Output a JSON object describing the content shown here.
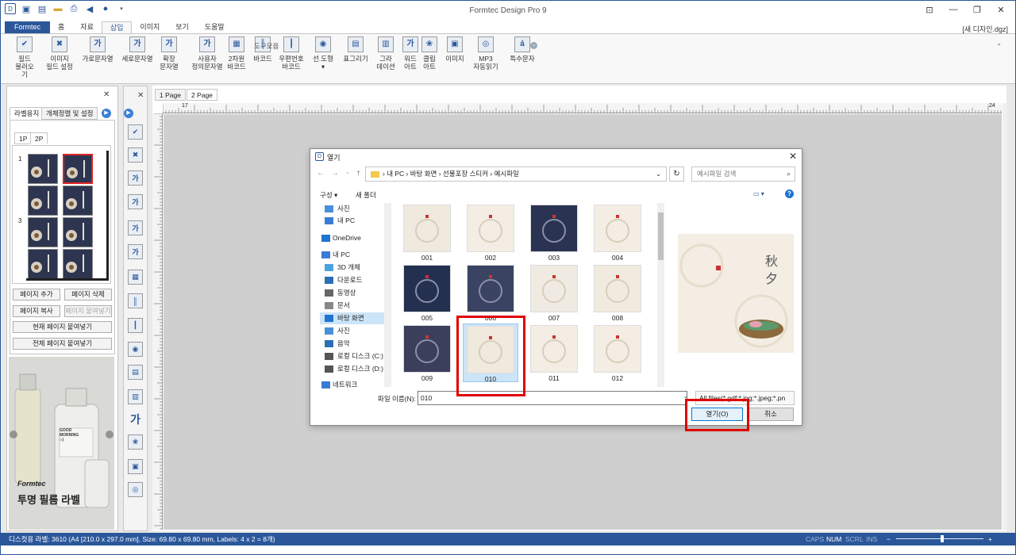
{
  "app": {
    "title": "Formtec Design Pro 9",
    "filename": "[새 디자인.dgz]"
  },
  "ribbon_tabs": [
    "Formtec",
    "홈",
    "자료",
    "삽입",
    "이미지",
    "보기",
    "도움말"
  ],
  "ribbon_buttons": [
    {
      "label": "필드\n불러오기",
      "icon": "field-load-icon",
      "glyph": "✔"
    },
    {
      "label": "이미지\n필드 설정",
      "icon": "image-field-icon",
      "glyph": "✖"
    },
    {
      "label": "가로문자열",
      "icon": "horizontal-text-icon",
      "glyph": "가"
    },
    {
      "label": "세로문자열",
      "icon": "vertical-text-icon",
      "glyph": "가"
    },
    {
      "label": "확장\n문자열",
      "icon": "extended-text-icon",
      "glyph": "가"
    },
    {
      "label": "사용자\n정의문자열",
      "icon": "custom-text-icon",
      "glyph": "가"
    },
    {
      "label": "2차원\n바코드",
      "icon": "qr-code-icon",
      "glyph": "▦"
    },
    {
      "label": "바코드",
      "icon": "barcode-icon",
      "glyph": "║"
    },
    {
      "label": "우편번호\n바코드",
      "icon": "postal-barcode-icon",
      "glyph": "┃"
    },
    {
      "label": "선.도형\n▾",
      "icon": "shape-icon",
      "glyph": "◉"
    },
    {
      "label": "표그리기",
      "icon": "table-icon",
      "glyph": "▤"
    },
    {
      "label": "그라\n데이션",
      "icon": "gradient-icon",
      "glyph": "▥"
    },
    {
      "label": "워드\n아트",
      "icon": "word-art-icon",
      "glyph": "가"
    },
    {
      "label": "클립\n아트",
      "icon": "clip-art-icon",
      "glyph": "❀"
    },
    {
      "label": "이미지",
      "icon": "image-icon",
      "glyph": "▣"
    },
    {
      "label": "MP3\n자동읽기",
      "icon": "mp3-icon",
      "glyph": "◎"
    },
    {
      "label": "특수문자",
      "icon": "special-char-icon",
      "glyph": "á"
    }
  ],
  "ribbon_group": "도구모음",
  "left_panel": {
    "tabs": [
      "라벨용지",
      "개체정렬 및 설정"
    ],
    "page_tabs": [
      "1P",
      "2P"
    ],
    "row_labels": [
      "1",
      "3"
    ],
    "buttons": [
      "페이지 추가",
      "페이지 삭제",
      "페이지 복사",
      "페이지 붙여넣기",
      "현재 페이지 붙여넣기",
      "전체 페이지 붙여넣기"
    ],
    "ad": {
      "brand": "Formtec",
      "text": "투명 필름 라벨"
    }
  },
  "doc_tabs": [
    "1 Page",
    "2 Page"
  ],
  "ruler_labels": [
    "17",
    "24"
  ],
  "dialog": {
    "title": "열기",
    "path": "› 내 PC  ›  바탕 화면  ›  선물포장 스티커  ›  예시파일",
    "search_placeholder": "예시파일 검색",
    "organize": "구성 ▾",
    "new_folder": "새 폴더",
    "nav_items": [
      "사진",
      "내 PC",
      "OneDrive",
      "내 PC",
      "3D 개체",
      "다운로드",
      "동영상",
      "문서",
      "바탕 화면",
      "사진",
      "음악",
      "로컬 디스크 (C:)",
      "로컬 디스크 (D:)",
      "네트워크"
    ],
    "files": [
      "001",
      "002",
      "003",
      "004",
      "005",
      "006",
      "007",
      "008",
      "009",
      "010",
      "011",
      "012"
    ],
    "selected_file": "010",
    "filename_label": "파일 이름(N):",
    "filename_value": "010",
    "filter": "All files(*.gdf;*.jpg;*.jpeg;*.pn",
    "open": "열기(O)",
    "cancel": "취소"
  },
  "status": {
    "text": "디스컷용 라벨: 3610 (A4 [210.0 x 297.0 mm], Size: 69.80 x 69.80 mm, Labels: 4 x 2 = 8개)",
    "caps": "CAPS",
    "num": "NUM",
    "scrl": "SCRL",
    "ins": "INS"
  },
  "colors": {
    "accent": "#2b579a",
    "highlight": "#e00000",
    "selection": "#cce4f7"
  }
}
